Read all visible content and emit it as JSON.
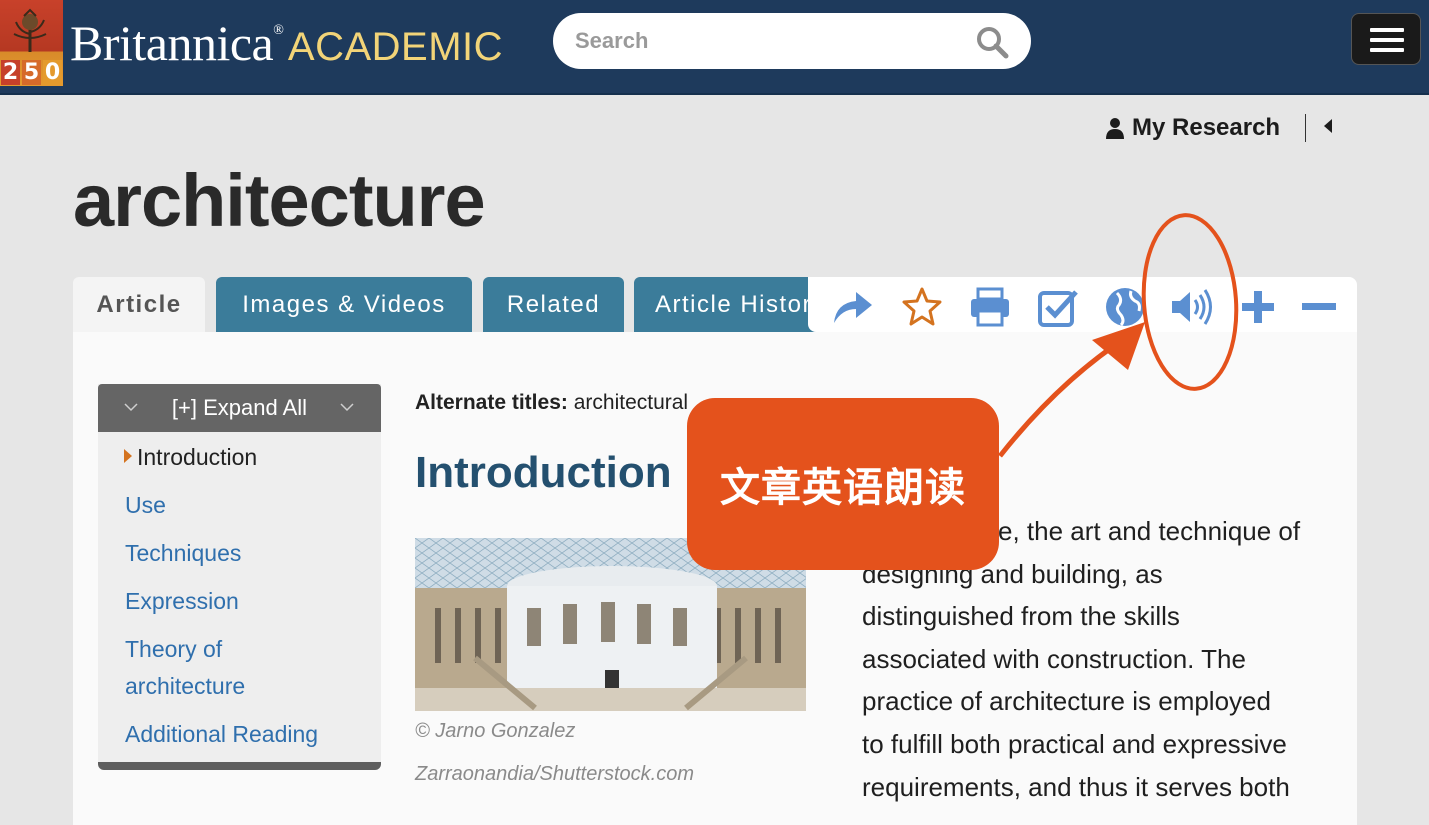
{
  "header": {
    "logo_number": [
      "2",
      "5",
      "0"
    ],
    "brand_name": "Britannica",
    "brand_reg": "®",
    "brand_product": "ACADEMIC",
    "search_placeholder": "Search"
  },
  "user_bar": {
    "my_research": "My Research"
  },
  "page_title": "architecture",
  "tabs": [
    {
      "label": "Article",
      "active": true
    },
    {
      "label": "Images & Videos",
      "active": false
    },
    {
      "label": "Related",
      "active": false
    },
    {
      "label": "Article History",
      "active": false
    }
  ],
  "toolbar_icons": [
    "share-icon",
    "star-icon",
    "print-icon",
    "checkbox-icon",
    "globe-icon",
    "speaker-icon",
    "plus-icon",
    "minus-icon"
  ],
  "sidebar": {
    "expand_all": "[+] Expand All",
    "items": [
      {
        "label": "Introduction",
        "active": true
      },
      {
        "label": "Use",
        "active": false
      },
      {
        "label": "Techniques",
        "active": false
      },
      {
        "label": "Expression",
        "active": false
      },
      {
        "label": "Theory of",
        "active": false
      },
      {
        "label": "architecture",
        "active": false
      },
      {
        "label": "Additional Reading",
        "active": false
      }
    ]
  },
  "article": {
    "alt_titles_label": "Alternate titles:",
    "alt_titles_value": "architectural",
    "section_heading": "Introduction",
    "image_caption_line1": "© Jarno Gonzalez",
    "image_caption_line2": "Zarraonandia/Shutterstock.com",
    "body_lines": [
      "e, the art and technique of",
      "designing and building, as",
      "distinguished from the skills",
      "associated with construction. The",
      "practice of architecture is employed",
      "to fulfill both practical and expressive",
      "requirements, and thus it serves both"
    ]
  },
  "annotation": {
    "callout_text": "文章英语朗读"
  },
  "colors": {
    "header_bg": "#1e3a5c",
    "tab_blue": "#3b7c9a",
    "link_blue": "#2f6fad",
    "heading_blue": "#24506f",
    "icon_blue": "#5b8fd1",
    "star_orange": "#d4731f",
    "annotation_orange": "#e4521c"
  }
}
